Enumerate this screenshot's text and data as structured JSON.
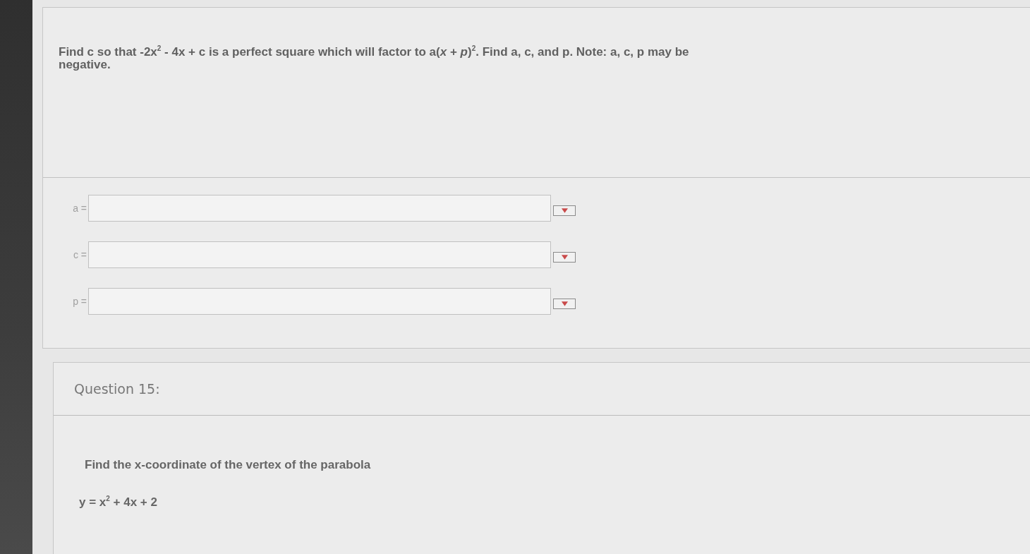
{
  "questions": [
    {
      "prompt": "Find c so that -2x$^{2}$ - 4x + c is a perfect square which will factor to a(*x* + *p*)$^{2}$. Find a, c, and p. Note: a, c, p may be negative.",
      "answers": [
        {
          "label": "a ="
        },
        {
          "label": "c ="
        },
        {
          "label": "p ="
        }
      ]
    },
    {
      "heading": "Question 15:",
      "prompt": "Find the x-coordinate of the vertex of the parabola",
      "equation": "y = x$^{2}$ + 4x + 2"
    }
  ]
}
